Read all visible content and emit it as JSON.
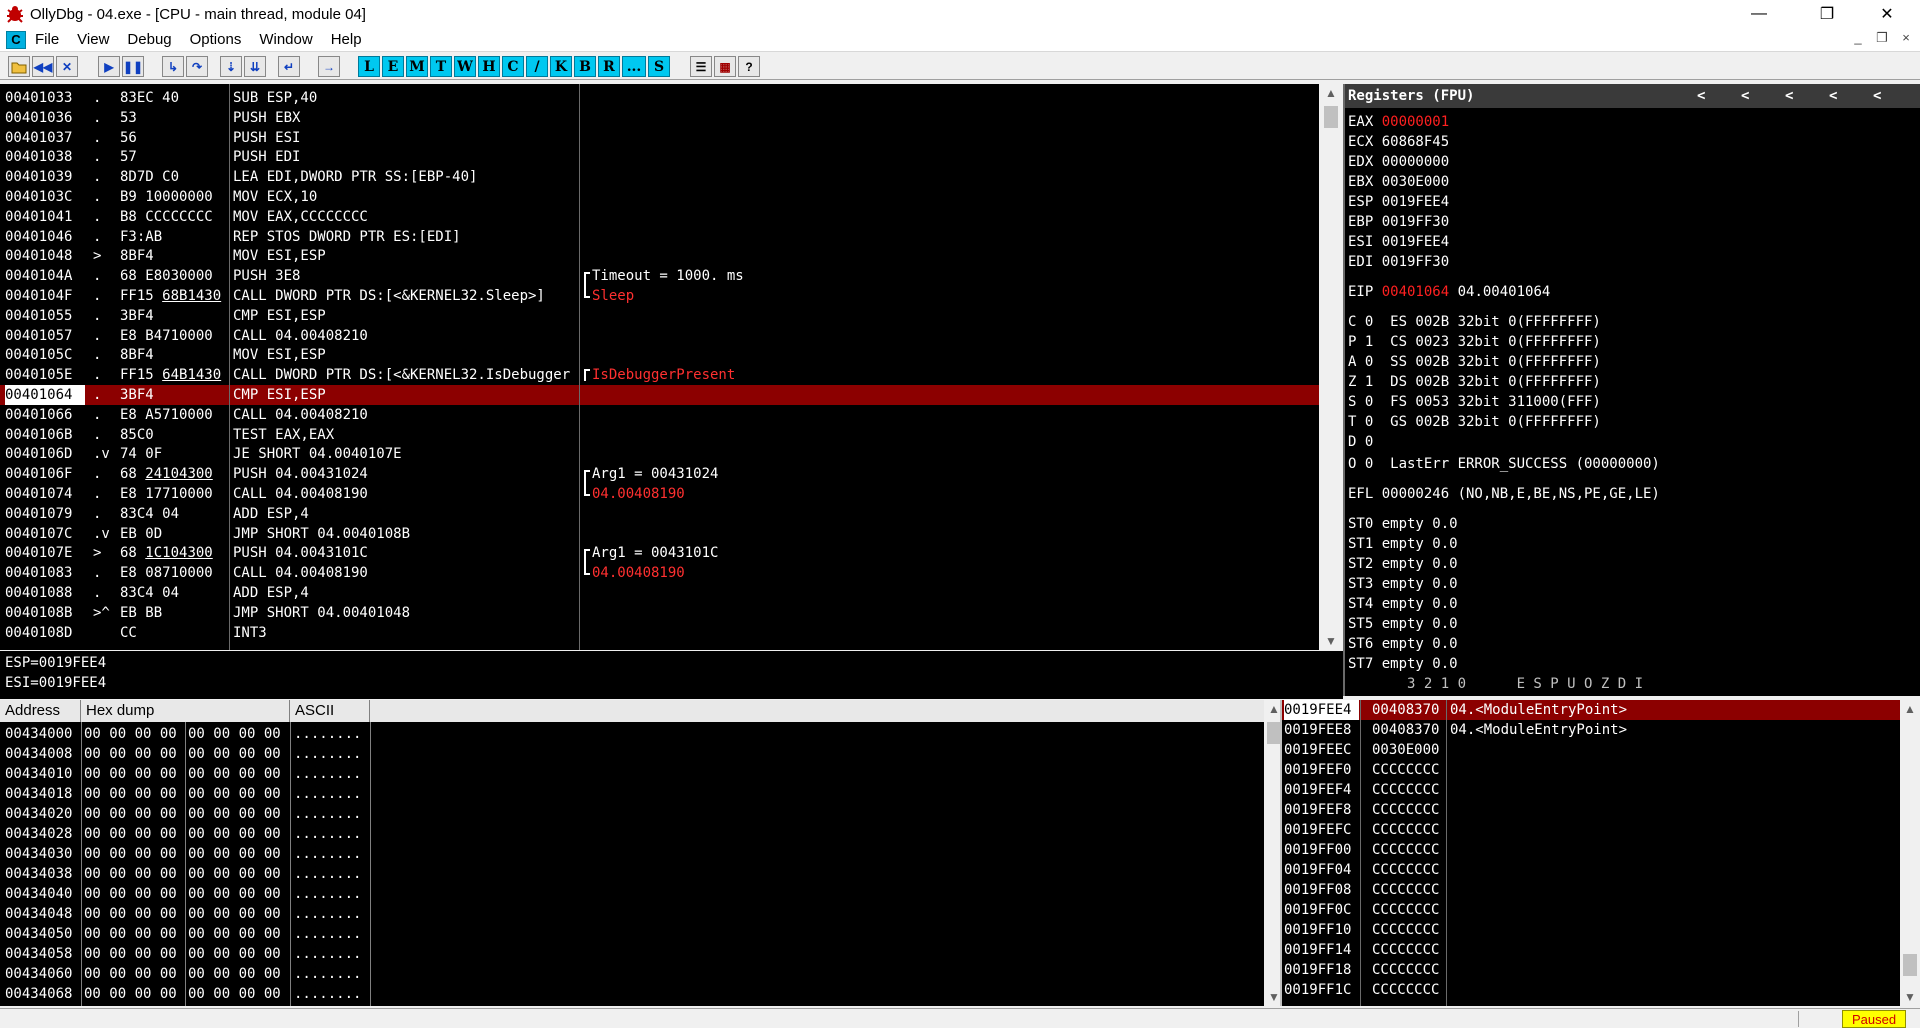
{
  "window": {
    "title": "OllyDbg - 04.exe - [CPU - main thread, module 04]",
    "minimize": "—",
    "restore": "❐",
    "close": "✕"
  },
  "menu": {
    "items": [
      "File",
      "View",
      "Debug",
      "Options",
      "Window",
      "Help"
    ],
    "mdi_min": "_",
    "mdi_restore": "❐",
    "mdi_close": "×"
  },
  "toolbar": {
    "letter_buttons": [
      "L",
      "E",
      "M",
      "T",
      "W",
      "H",
      "C",
      "/",
      "K",
      "B",
      "R",
      "...",
      "S"
    ]
  },
  "cpu": {
    "rows": [
      {
        "addr": "00401033",
        "mark": ".",
        "hex": "83EC 40",
        "dis": "SUB ESP,40",
        "cmt": ""
      },
      {
        "addr": "00401036",
        "mark": ".",
        "hex": "53",
        "dis": "PUSH EBX",
        "cmt": ""
      },
      {
        "addr": "00401037",
        "mark": ".",
        "hex": "56",
        "dis": "PUSH ESI",
        "cmt": ""
      },
      {
        "addr": "00401038",
        "mark": ".",
        "hex": "57",
        "dis": "PUSH EDI",
        "cmt": ""
      },
      {
        "addr": "00401039",
        "mark": ".",
        "hex": "8D7D C0",
        "dis": "LEA EDI,DWORD PTR SS:[EBP-40]",
        "cmt": ""
      },
      {
        "addr": "0040103C",
        "mark": ".",
        "hex": "B9 10000000",
        "dis": "MOV ECX,10",
        "cmt": ""
      },
      {
        "addr": "00401041",
        "mark": ".",
        "hex": "B8 CCCCCCCC",
        "dis": "MOV EAX,CCCCCCCC",
        "cmt": ""
      },
      {
        "addr": "00401046",
        "mark": ".",
        "hex": "F3:AB",
        "dis": "REP STOS DWORD PTR ES:[EDI]",
        "cmt": ""
      },
      {
        "addr": "00401048",
        "mark": ">",
        "hex": "8BF4",
        "dis": "MOV ESI,ESP",
        "cmt": ""
      },
      {
        "addr": "0040104A",
        "mark": ".",
        "hex": "68 E8030000",
        "dis": "PUSH 3E8",
        "cmt": "Timeout = 1000. ms"
      },
      {
        "addr": "0040104F",
        "mark": ".",
        "hex": "FF15 68B1430",
        "dis": "CALL DWORD PTR DS:[<&KERNEL32.Sleep>]",
        "cmt": "Sleep"
      },
      {
        "addr": "00401055",
        "mark": ".",
        "hex": "3BF4",
        "dis": "CMP ESI,ESP",
        "cmt": ""
      },
      {
        "addr": "00401057",
        "mark": ".",
        "hex": "E8 B4710000",
        "dis": "CALL 04.00408210",
        "cmt": ""
      },
      {
        "addr": "0040105C",
        "mark": ".",
        "hex": "8BF4",
        "dis": "MOV ESI,ESP",
        "cmt": ""
      },
      {
        "addr": "0040105E",
        "mark": ".",
        "hex": "FF15 64B1430",
        "dis": "CALL DWORD PTR DS:[<&KERNEL32.IsDebugger",
        "cmt": "IsDebuggerPresent"
      },
      {
        "addr": "00401064",
        "mark": ".",
        "hex": "3BF4",
        "dis": "CMP ESI,ESP",
        "cmt": ""
      },
      {
        "addr": "00401066",
        "mark": ".",
        "hex": "E8 A5710000",
        "dis": "CALL 04.00408210",
        "cmt": ""
      },
      {
        "addr": "0040106B",
        "mark": ".",
        "hex": "85C0",
        "dis": "TEST EAX,EAX",
        "cmt": ""
      },
      {
        "addr": "0040106D",
        "mark": ".v",
        "hex": "74 0F",
        "dis": "JE SHORT 04.0040107E",
        "cmt": ""
      },
      {
        "addr": "0040106F",
        "mark": ".",
        "hex": "68 24104300",
        "dis": "PUSH 04.00431024",
        "cmt": "Arg1 = 00431024"
      },
      {
        "addr": "00401074",
        "mark": ".",
        "hex": "E8 17710000",
        "dis": "CALL 04.00408190",
        "cmt": "04.00408190"
      },
      {
        "addr": "00401079",
        "mark": ".",
        "hex": "83C4 04",
        "dis": "ADD ESP,4",
        "cmt": ""
      },
      {
        "addr": "0040107C",
        "mark": ".v",
        "hex": "EB 0D",
        "dis": "JMP SHORT 04.0040108B",
        "cmt": ""
      },
      {
        "addr": "0040107E",
        "mark": ">",
        "hex": "68 1C104300",
        "dis": "PUSH 04.0043101C",
        "cmt": "Arg1 = 0043101C"
      },
      {
        "addr": "00401083",
        "mark": ".",
        "hex": "E8 08710000",
        "dis": "CALL 04.00408190",
        "cmt": "04.00408190"
      },
      {
        "addr": "00401088",
        "mark": ".",
        "hex": "83C4 04",
        "dis": "ADD ESP,4",
        "cmt": ""
      },
      {
        "addr": "0040108B",
        "mark": ">^",
        "hex": "EB BB",
        "dis": "JMP SHORT 04.00401048",
        "cmt": ""
      },
      {
        "addr": "0040108D",
        "mark": "",
        "hex": "CC",
        "dis": "INT3",
        "cmt": ""
      }
    ],
    "selected_addr": "00401064"
  },
  "info": {
    "line1": "ESP=0019FEE4",
    "line2": "ESI=0019FEE4"
  },
  "registers": {
    "title": "Registers (FPU)",
    "nav": [
      "<",
      "<",
      "<",
      "<",
      "<"
    ],
    "gp": [
      {
        "name": "EAX",
        "value": "00000001",
        "changed": true,
        "extra": ""
      },
      {
        "name": "ECX",
        "value": "60868F45",
        "changed": false,
        "extra": ""
      },
      {
        "name": "EDX",
        "value": "00000000",
        "changed": false,
        "extra": ""
      },
      {
        "name": "EBX",
        "value": "0030E000",
        "changed": false,
        "extra": ""
      },
      {
        "name": "ESP",
        "value": "0019FEE4",
        "changed": false,
        "extra": ""
      },
      {
        "name": "EBP",
        "value": "0019FF30",
        "changed": false,
        "extra": ""
      },
      {
        "name": "ESI",
        "value": "0019FEE4",
        "changed": false,
        "extra": ""
      },
      {
        "name": "EDI",
        "value": "0019FF30",
        "changed": false,
        "extra": ""
      }
    ],
    "eip": {
      "name": "EIP",
      "value": "00401064",
      "extra": "04.00401064"
    },
    "flags": [
      "C 0  ES 002B 32bit 0(FFFFFFFF)",
      "P 1  CS 0023 32bit 0(FFFFFFFF)",
      "A 0  SS 002B 32bit 0(FFFFFFFF)",
      "Z 1  DS 002B 32bit 0(FFFFFFFF)",
      "S 0  FS 0053 32bit 311000(FFF)",
      "T 0  GS 002B 32bit 0(FFFFFFFF)",
      "D 0",
      "O 0  LastErr ERROR_SUCCESS (00000000)"
    ],
    "efl": "EFL 00000246 (NO,NB,E,BE,NS,PE,GE,LE)",
    "fpu": [
      "ST0 empty 0.0",
      "ST1 empty 0.0",
      "ST2 empty 0.0",
      "ST3 empty 0.0",
      "ST4 empty 0.0",
      "ST5 empty 0.0",
      "ST6 empty 0.0",
      "ST7 empty 0.0"
    ],
    "fpu_footer": "       3 2 1 0      E S P U O Z D I"
  },
  "dump": {
    "headers": {
      "address": "Address",
      "hex": "Hex dump",
      "ascii": "ASCII"
    },
    "rows": [
      {
        "addr": "00434000",
        "hex1": "00 00 00 00",
        "hex2": "00 00 00 00",
        "ascii": "........"
      },
      {
        "addr": "00434008",
        "hex1": "00 00 00 00",
        "hex2": "00 00 00 00",
        "ascii": "........"
      },
      {
        "addr": "00434010",
        "hex1": "00 00 00 00",
        "hex2": "00 00 00 00",
        "ascii": "........"
      },
      {
        "addr": "00434018",
        "hex1": "00 00 00 00",
        "hex2": "00 00 00 00",
        "ascii": "........"
      },
      {
        "addr": "00434020",
        "hex1": "00 00 00 00",
        "hex2": "00 00 00 00",
        "ascii": "........"
      },
      {
        "addr": "00434028",
        "hex1": "00 00 00 00",
        "hex2": "00 00 00 00",
        "ascii": "........"
      },
      {
        "addr": "00434030",
        "hex1": "00 00 00 00",
        "hex2": "00 00 00 00",
        "ascii": "........"
      },
      {
        "addr": "00434038",
        "hex1": "00 00 00 00",
        "hex2": "00 00 00 00",
        "ascii": "........"
      },
      {
        "addr": "00434040",
        "hex1": "00 00 00 00",
        "hex2": "00 00 00 00",
        "ascii": "........"
      },
      {
        "addr": "00434048",
        "hex1": "00 00 00 00",
        "hex2": "00 00 00 00",
        "ascii": "........"
      },
      {
        "addr": "00434050",
        "hex1": "00 00 00 00",
        "hex2": "00 00 00 00",
        "ascii": "........"
      },
      {
        "addr": "00434058",
        "hex1": "00 00 00 00",
        "hex2": "00 00 00 00",
        "ascii": "........"
      },
      {
        "addr": "00434060",
        "hex1": "00 00 00 00",
        "hex2": "00 00 00 00",
        "ascii": "........"
      },
      {
        "addr": "00434068",
        "hex1": "00 00 00 00",
        "hex2": "00 00 00 00",
        "ascii": "........"
      }
    ]
  },
  "stack": {
    "rows": [
      {
        "addr": "0019FEE4",
        "val": "00408370",
        "cmt": "04.<ModuleEntryPoint>"
      },
      {
        "addr": "0019FEE8",
        "val": "00408370",
        "cmt": "04.<ModuleEntryPoint>"
      },
      {
        "addr": "0019FEEC",
        "val": "0030E000",
        "cmt": ""
      },
      {
        "addr": "0019FEF0",
        "val": "CCCCCCCC",
        "cmt": ""
      },
      {
        "addr": "0019FEF4",
        "val": "CCCCCCCC",
        "cmt": ""
      },
      {
        "addr": "0019FEF8",
        "val": "CCCCCCCC",
        "cmt": ""
      },
      {
        "addr": "0019FEFC",
        "val": "CCCCCCCC",
        "cmt": ""
      },
      {
        "addr": "0019FF00",
        "val": "CCCCCCCC",
        "cmt": ""
      },
      {
        "addr": "0019FF04",
        "val": "CCCCCCCC",
        "cmt": ""
      },
      {
        "addr": "0019FF08",
        "val": "CCCCCCCC",
        "cmt": ""
      },
      {
        "addr": "0019FF0C",
        "val": "CCCCCCCC",
        "cmt": ""
      },
      {
        "addr": "0019FF10",
        "val": "CCCCCCCC",
        "cmt": ""
      },
      {
        "addr": "0019FF14",
        "val": "CCCCCCCC",
        "cmt": ""
      },
      {
        "addr": "0019FF18",
        "val": "CCCCCCCC",
        "cmt": ""
      },
      {
        "addr": "0019FF1C",
        "val": "CCCCCCCC",
        "cmt": ""
      }
    ],
    "selected_addr": "0019FEE4"
  },
  "status": {
    "state": "Paused"
  },
  "colors": {
    "selection": "#8c0000",
    "changed_value": "#ff2020",
    "api_comment": "#ff3030",
    "letter_button": "#00c8f0",
    "status_badge": "#ffff00"
  }
}
